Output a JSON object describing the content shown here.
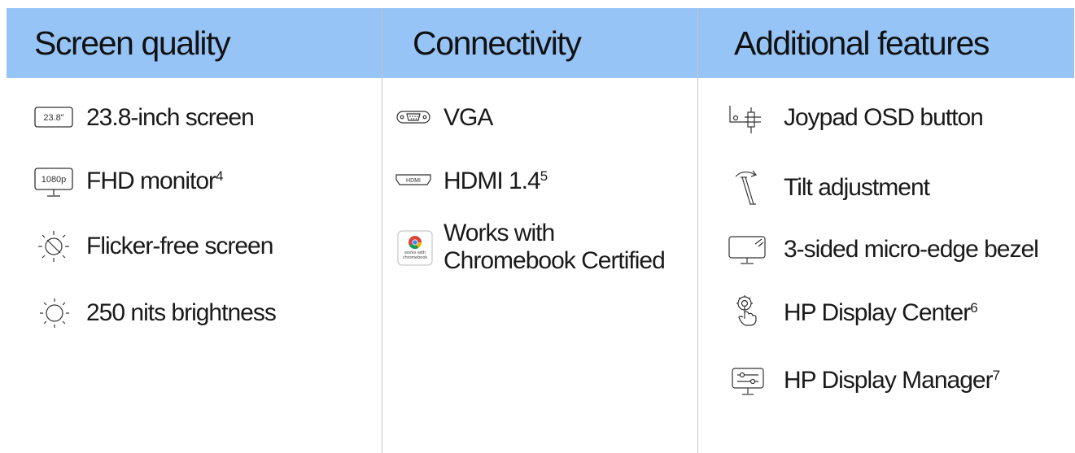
{
  "columns": [
    {
      "title": "Screen quality",
      "items": [
        {
          "icon": "screen-size-icon",
          "icon_text": "23.8\"",
          "label": "23.8-inch screen"
        },
        {
          "icon": "monitor-1080p-icon",
          "icon_text": "1080p",
          "label": "FHD monitor",
          "sup": "4"
        },
        {
          "icon": "flicker-free-icon",
          "label": "Flicker-free screen"
        },
        {
          "icon": "brightness-sun-icon",
          "label": "250 nits brightness"
        }
      ]
    },
    {
      "title": "Connectivity",
      "items": [
        {
          "icon": "vga-port-icon",
          "label": "VGA"
        },
        {
          "icon": "hdmi-port-icon",
          "icon_text": "HDMI",
          "label": "HDMI 1.4",
          "sup": "5"
        },
        {
          "icon": "chromebook-certified-icon",
          "icon_text": "works with chromebook",
          "label_line1": "Works with",
          "label_line2": "Chromebook Certified"
        }
      ]
    },
    {
      "title": "Additional features",
      "items": [
        {
          "icon": "joypad-icon",
          "label": "Joypad OSD button"
        },
        {
          "icon": "tilt-icon",
          "label": "Tilt adjustment"
        },
        {
          "icon": "micro-edge-bezel-icon",
          "label": "3-sided micro-edge bezel"
        },
        {
          "icon": "touch-gear-icon",
          "label": "HP Display Center",
          "sup": "6"
        },
        {
          "icon": "display-manager-icon",
          "label": "HP Display Manager",
          "sup": "7"
        }
      ]
    }
  ],
  "colors": {
    "header_band": "#96c4f7",
    "text": "#1a1a1a",
    "divider": "#c6c6c6",
    "icon_stroke": "#333333"
  }
}
